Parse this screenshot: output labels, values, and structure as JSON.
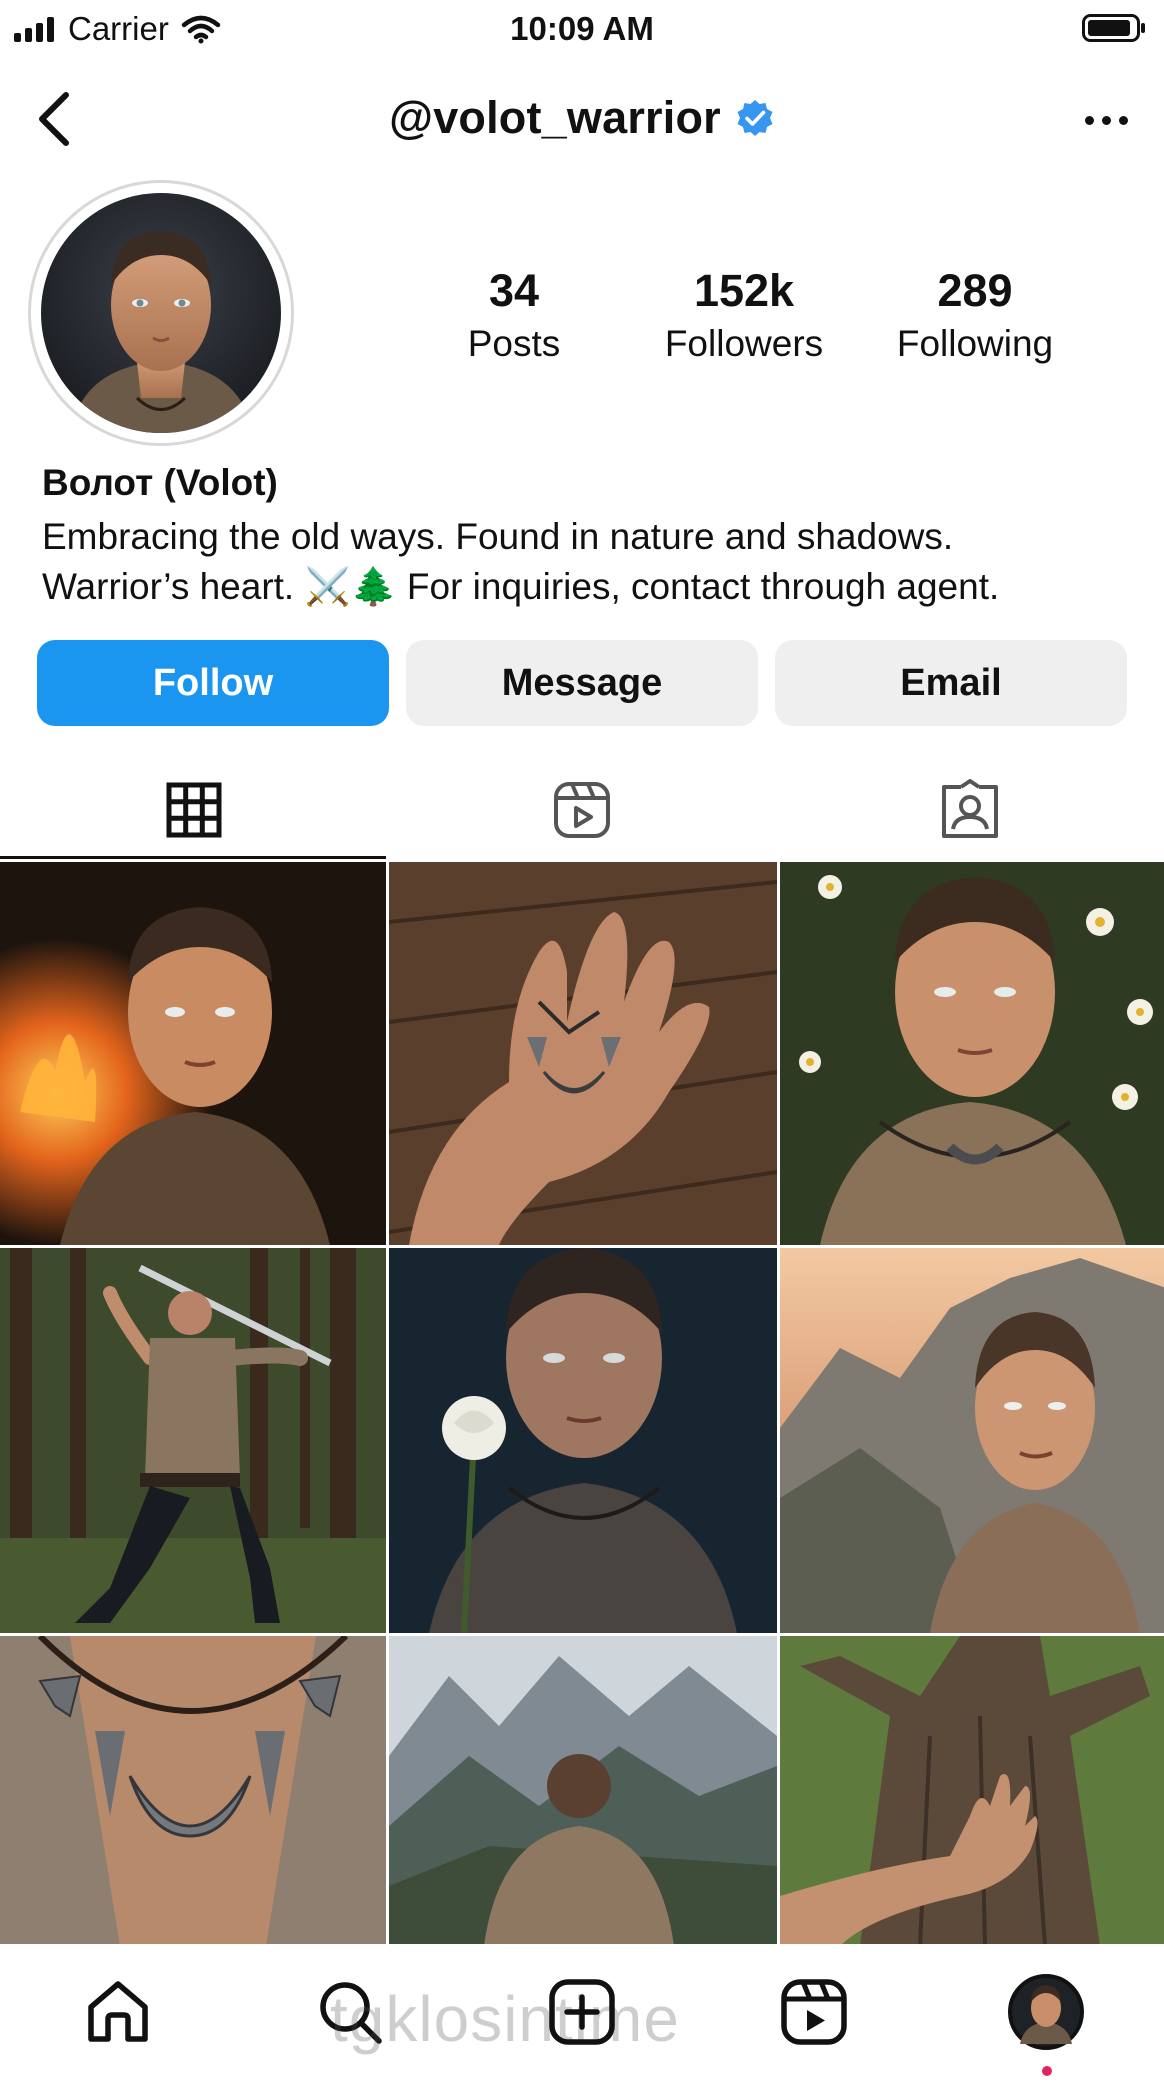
{
  "status_bar": {
    "carrier": "Carrier",
    "time": "10:09 AM"
  },
  "header": {
    "handle": "@volot_warrior",
    "verified": true
  },
  "stats": [
    {
      "value": "34",
      "label": "Posts"
    },
    {
      "value": "152k",
      "label": "Followers"
    },
    {
      "value": "289",
      "label": "Following"
    }
  ],
  "bio": {
    "name": "Волот (Volot)",
    "line1": "Embracing the old ways. Found in nature and shadows.",
    "line2": "Warrior’s heart. ⚔️🌲 For inquiries, contact through agent."
  },
  "buttons": {
    "follow": "Follow",
    "message": "Message",
    "email": "Email"
  },
  "tabs": [
    {
      "icon": "grid-icon",
      "active": true
    },
    {
      "icon": "reels-icon",
      "active": false
    },
    {
      "icon": "tagged-icon",
      "active": false
    }
  ],
  "grid_posts": [
    "portrait-by-campfire",
    "hand-holding-pendant",
    "portrait-with-daisies",
    "sword-stance-in-forest",
    "rain-portrait-with-white-rose",
    "sunset-cliff-portrait",
    "axe-and-crescent-necklace",
    "back-view-mountains",
    "hand-on-tree-bark"
  ],
  "bottom_nav": {
    "items": [
      "home-icon",
      "search-icon",
      "create-icon",
      "reels-icon",
      "profile-avatar"
    ],
    "watermark": "tgklosintime"
  },
  "colors": {
    "accent": "#1a96f0",
    "verified": "#3797f0",
    "notification_dot": "#e0245e"
  }
}
